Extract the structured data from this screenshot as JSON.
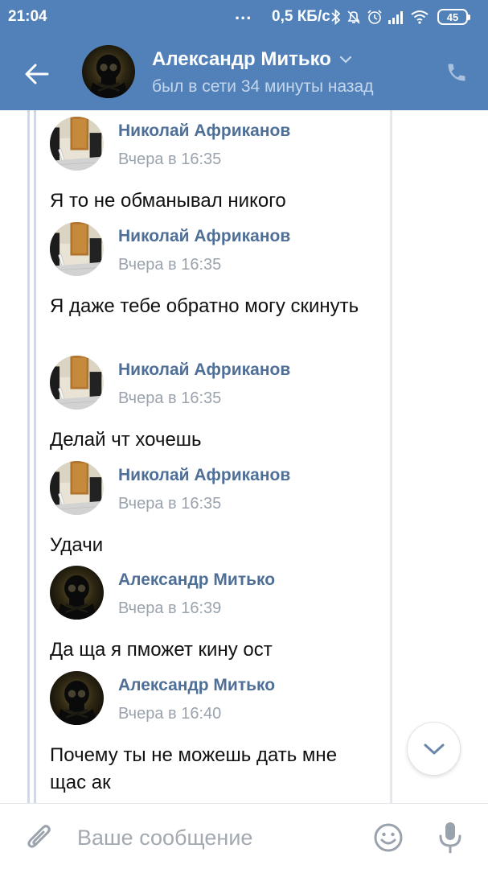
{
  "status_bar": {
    "time": "21:04",
    "dots": "...",
    "network_speed": "0,5 КБ/с",
    "battery": "45",
    "icons": [
      "bluetooth-icon",
      "mute-icon",
      "alarm-icon",
      "signal-icon",
      "wifi-icon",
      "battery-icon"
    ]
  },
  "header": {
    "contact_name": "Александр Митько",
    "last_seen": "был в сети 34 минуты назад",
    "icons": [
      "back-arrow-icon",
      "chevron-down-icon",
      "phone-icon"
    ]
  },
  "messages": [
    {
      "author": "Николай Африканов",
      "time": "Вчера в 16:35",
      "text": "Я то не обманывал никого",
      "avatar": "photo-avatar"
    },
    {
      "author": "Николай Африканов",
      "time": "Вчера в 16:35",
      "text": "Я даже тебе обратно могу скинуть",
      "avatar": "photo-avatar"
    },
    {
      "author": "Николай Африканов",
      "time": "Вчера в 16:35",
      "text": "Делай чт хочешь",
      "avatar": "photo-avatar"
    },
    {
      "author": "Николай Африканов",
      "time": "Вчера в 16:35",
      "text": "Удачи",
      "avatar": "photo-avatar"
    },
    {
      "author": "Александр Митько",
      "time": "Вчера в 16:39",
      "text": "Да ща я пможет кину ост",
      "avatar": "skull-avatar"
    },
    {
      "author": "Александр Митько",
      "time": "Вчера в 16:40",
      "text": "Почему ты не можешь дать мне щас ак",
      "avatar": "skull-avatar"
    }
  ],
  "composer": {
    "placeholder": "Ваше сообщение",
    "value": "",
    "icons": [
      "paperclip-icon",
      "emoji-icon",
      "microphone-icon"
    ]
  },
  "colors": {
    "header_bg": "#5181b8",
    "author_name": "#4f6f97",
    "timestamp": "#9aa3ad",
    "message_text": "#111111"
  }
}
